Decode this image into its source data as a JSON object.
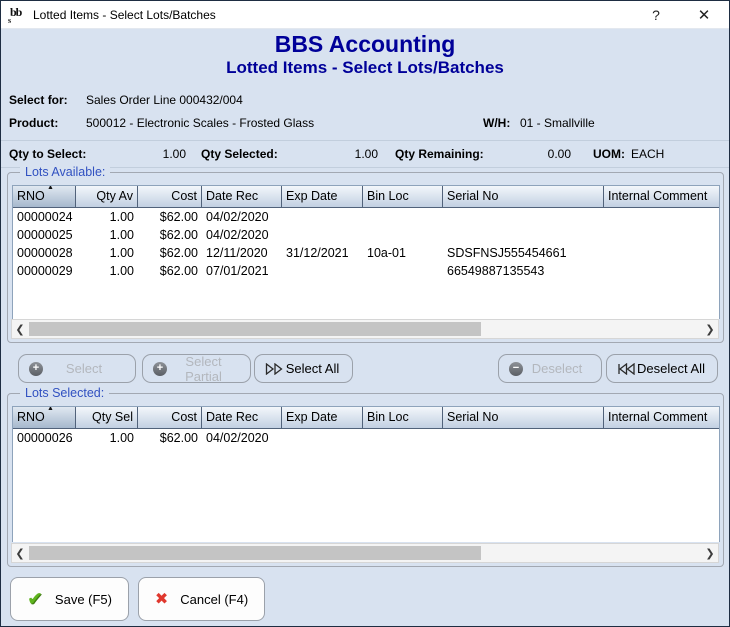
{
  "window": {
    "title": "Lotted Items - Select Lots/Batches",
    "help_button": "?",
    "close_button": "✕"
  },
  "header": {
    "app_title": "BBS Accounting",
    "screen_title": "Lotted Items - Select Lots/Batches"
  },
  "info": {
    "select_for_label": "Select for:",
    "select_for_value": "Sales Order Line 000432/004",
    "product_label": "Product:",
    "product_value": "500012 - Electronic Scales - Frosted Glass",
    "wh_label": "W/H:",
    "wh_value": "01 - Smallville"
  },
  "qty": {
    "to_select_label": "Qty to Select:",
    "to_select_value": "1.00",
    "selected_label": "Qty Selected:",
    "selected_value": "1.00",
    "remaining_label": "Qty Remaining:",
    "remaining_value": "0.00",
    "uom_label": "UOM:",
    "uom_value": "EACH"
  },
  "lots_available": {
    "group_label": "Lots Available:",
    "columns": [
      "RNO",
      "Qty Av",
      "Cost",
      "Date Rec",
      "Exp Date",
      "Bin Loc",
      "Serial No",
      "Internal Comment"
    ],
    "rows": [
      [
        "00000024",
        "1.00",
        "$62.00",
        "04/02/2020",
        "",
        "",
        "",
        ""
      ],
      [
        "00000025",
        "1.00",
        "$62.00",
        "04/02/2020",
        "",
        "",
        "",
        ""
      ],
      [
        "00000028",
        "1.00",
        "$62.00",
        "12/11/2020",
        "31/12/2021",
        "10a-01",
        "SDSFNSJ555454661",
        ""
      ],
      [
        "00000029",
        "1.00",
        "$62.00",
        "07/01/2021",
        "",
        "",
        "66549887135543",
        ""
      ]
    ]
  },
  "lots_selected": {
    "group_label": "Lots Selected:",
    "columns": [
      "RNO",
      "Qty Sel",
      "Cost",
      "Date Rec",
      "Exp Date",
      "Bin Loc",
      "Serial No",
      "Internal Comment"
    ],
    "rows": [
      [
        "00000026",
        "1.00",
        "$62.00",
        "04/02/2020",
        "",
        "",
        "",
        ""
      ]
    ]
  },
  "actions": {
    "select": "Select",
    "select_partial": "Select Partial",
    "select_all": "Select All",
    "deselect": "Deselect",
    "deselect_all": "Deselect All",
    "save": "Save (F5)",
    "cancel": "Cancel (F4)"
  },
  "icons": {
    "sort_ascending": "▲",
    "scroll_left": "❮",
    "scroll_right": "❯",
    "plus": "+",
    "minus": "−",
    "check": "✔",
    "cross": "✖"
  },
  "colors": {
    "heading_navy": "#000099",
    "group_label_blue": "#3151c1",
    "dialog_background": "#d8e2f0",
    "save_check_green": "#5fb41e",
    "cancel_cross_red": "#e0382e"
  }
}
